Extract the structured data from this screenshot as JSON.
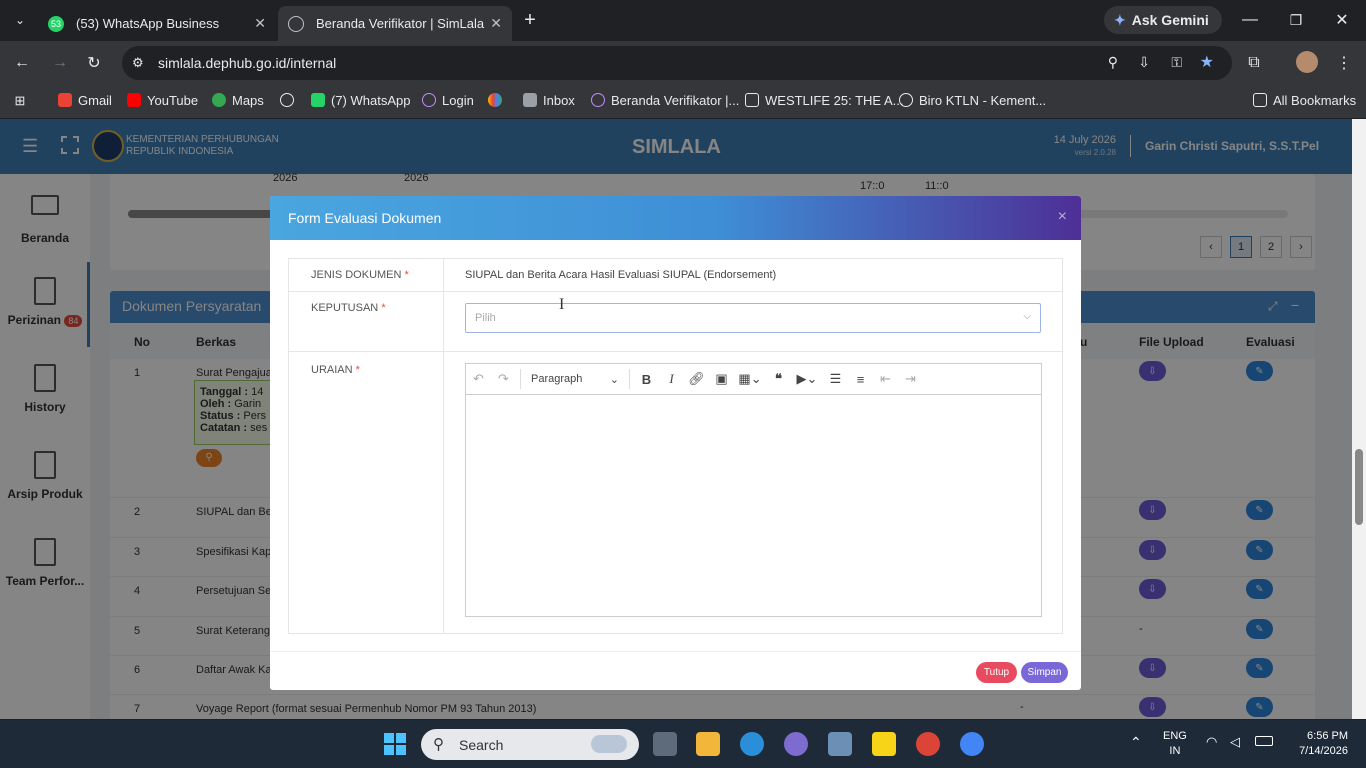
{
  "browser": {
    "tabs": [
      {
        "label": "(53) WhatsApp Business",
        "badge": "53"
      },
      {
        "label": "Beranda Verifikator | SimLala"
      }
    ],
    "url": "simlala.dephub.go.id/internal",
    "ask_gemini": "Ask Gemini",
    "bookmarks": [
      "Gmail",
      "YouTube",
      "Maps",
      "(7) WhatsApp",
      "Login",
      "Inbox",
      "Beranda Verifikator |...",
      "WESTLIFE 25: THE A...",
      "Biro KTLN - Kement..."
    ],
    "all_bookmarks": "All Bookmarks"
  },
  "app": {
    "org_line1": "KEMENTERIAN PERHUBUNGAN",
    "org_line2": "REPUBLIK INDONESIA",
    "title": "SIMLALA",
    "date": "14 July 2026",
    "version": "versi 2.0.28",
    "user": "Garin Christi Saputri, S.S.T.Pel"
  },
  "sidebar": [
    {
      "label": "Beranda"
    },
    {
      "label": "Perizinan",
      "badge": "84"
    },
    {
      "label": "History"
    },
    {
      "label": "Arsip Produk"
    },
    {
      "label": "Team Perfor..."
    }
  ],
  "bg_table": {
    "years": [
      "2026",
      "2026"
    ],
    "times": [
      "17::0",
      "11::0"
    ],
    "pages": [
      "1",
      "2"
    ],
    "section_title": "Dokumen Persyaratan",
    "headers": [
      "No",
      "Berkas",
      "u",
      "File Upload",
      "Evaluasi"
    ],
    "rows": [
      {
        "no": "1",
        "berkas": "Surat Pengajuan"
      },
      {
        "no": "2",
        "berkas": "SIUPAL dan Beri"
      },
      {
        "no": "3",
        "berkas": "Spesifikasi Kapa"
      },
      {
        "no": "4",
        "berkas": "Persetujuan Seb"
      },
      {
        "no": "5",
        "berkas": "Surat Keterangan"
      },
      {
        "no": "6",
        "berkas": "Daftar Awak Kap"
      },
      {
        "no": "7",
        "berkas": "Voyage Report (format sesuai Permenhub Nomor PM 93 Tahun 2013)"
      }
    ],
    "dash5": "-",
    "dash7": "-",
    "info": {
      "tanggal": "Tanggal :",
      "tanggal_v": "14",
      "oleh": "Oleh :",
      "oleh_v": "Garin",
      "status": "Status :",
      "status_v": "Pers",
      "catatan": "Catatan :",
      "catatan_v": "ses"
    }
  },
  "modal": {
    "title": "Form Evaluasi Dokumen",
    "close": "×",
    "jenis_label": "JENIS DOKUMEN",
    "jenis_value": "SIUPAL dan Berita Acara Hasil Evaluasi SIUPAL (Endorsement)",
    "keputusan_label": "KEPUTUSAN",
    "keputusan_placeholder": "Pilih",
    "uraian_label": "URAIAN",
    "required_mark": "*",
    "editor_format": "Paragraph",
    "btn_tutup": "Tutup",
    "btn_simpan": "Simpan"
  },
  "taskbar": {
    "search": "Search",
    "lang1": "ENG",
    "lang2": "IN",
    "time": "6:56 PM",
    "date": "7/14/2026"
  },
  "colors": {
    "header": "#3e7fb5",
    "tutup": "#e84a5f",
    "simpan": "#7b68d8",
    "badge": "#e74c3c"
  }
}
